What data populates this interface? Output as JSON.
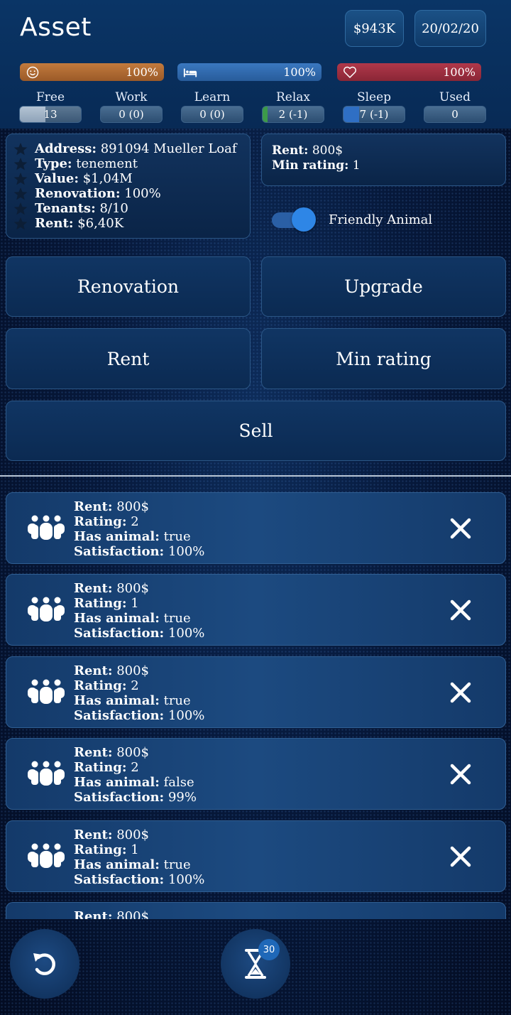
{
  "header": {
    "title": "Asset",
    "money": "$943K",
    "date": "20/02/20"
  },
  "stats": {
    "happiness": "100%",
    "sleep": "100%",
    "health": "100%"
  },
  "time": [
    {
      "label": "Free",
      "value": "13",
      "fill": 0.42
    },
    {
      "label": "Work",
      "value": "0 (0)",
      "fill": 0
    },
    {
      "label": "Learn",
      "value": "0 (0)",
      "fill": 0
    },
    {
      "label": "Relax",
      "value": "2 (-1)",
      "fill": 0.08
    },
    {
      "label": "Sleep",
      "value": "7 (-1)",
      "fill": 0.25
    },
    {
      "label": "Used",
      "value": "0",
      "fill": 0
    }
  ],
  "asset": {
    "address_label": "Address:",
    "address": "891094 Mueller Loaf",
    "type_label": "Type:",
    "type": "tenement",
    "value_label": "Value:",
    "value": "$1,04M",
    "renovation_label": "Renovation:",
    "renovation": "100%",
    "tenants_label": "Tenants:",
    "tenants": "8/10",
    "rent_label": "Rent:",
    "rent": "$6,40K"
  },
  "requirements": {
    "rent_label": "Rent:",
    "rent": "800$",
    "min_rating_label": "Min rating:",
    "min_rating": "1"
  },
  "toggle": {
    "label": "Friendly Animal",
    "on": true
  },
  "buttons": {
    "renovation": "Renovation",
    "upgrade": "Upgrade",
    "rent": "Rent",
    "min_rating": "Min rating",
    "sell": "Sell"
  },
  "tenant_labels": {
    "rent": "Rent:",
    "rating": "Rating:",
    "animal": "Has animal:",
    "satisfaction": "Satisfaction:"
  },
  "tenants": [
    {
      "rent": "800$",
      "rating": "2",
      "animal": "true",
      "satisfaction": "100%"
    },
    {
      "rent": "800$",
      "rating": "1",
      "animal": "true",
      "satisfaction": "100%"
    },
    {
      "rent": "800$",
      "rating": "2",
      "animal": "true",
      "satisfaction": "100%"
    },
    {
      "rent": "800$",
      "rating": "2",
      "animal": "false",
      "satisfaction": "99%"
    },
    {
      "rent": "800$",
      "rating": "1",
      "animal": "true",
      "satisfaction": "100%"
    },
    {
      "rent": "800$"
    }
  ],
  "footer": {
    "timer_badge": "30"
  },
  "colors": {
    "accent": "#2e86e6",
    "happiness": "#c27a3d",
    "sleep": "#3a78c0",
    "health": "#b0384a"
  }
}
